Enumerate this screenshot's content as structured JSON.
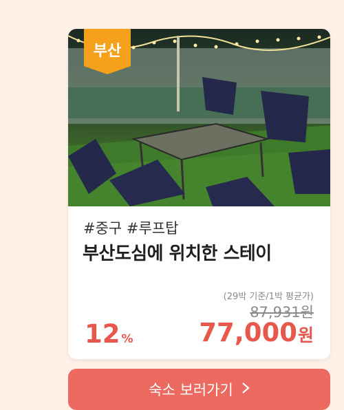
{
  "card": {
    "badge": "부산",
    "tags": "#중구 #루프탑",
    "title": "부산도심에 위치한 스테이",
    "price_note": "(29박 기준/1박 평균가)",
    "original_price": "87,931원",
    "discount_number": "12",
    "discount_unit": "%",
    "price_number": "77,000",
    "price_unit": "원",
    "photo_icon": "rooftop-terrace-photo"
  },
  "cta": {
    "label": "숙소 보러가기",
    "icon": "chevron-right-icon"
  },
  "colors": {
    "background": "#fdf0e6",
    "badge": "#f5a11c",
    "accent": "#e8574b",
    "cta": "#ec6a60"
  }
}
